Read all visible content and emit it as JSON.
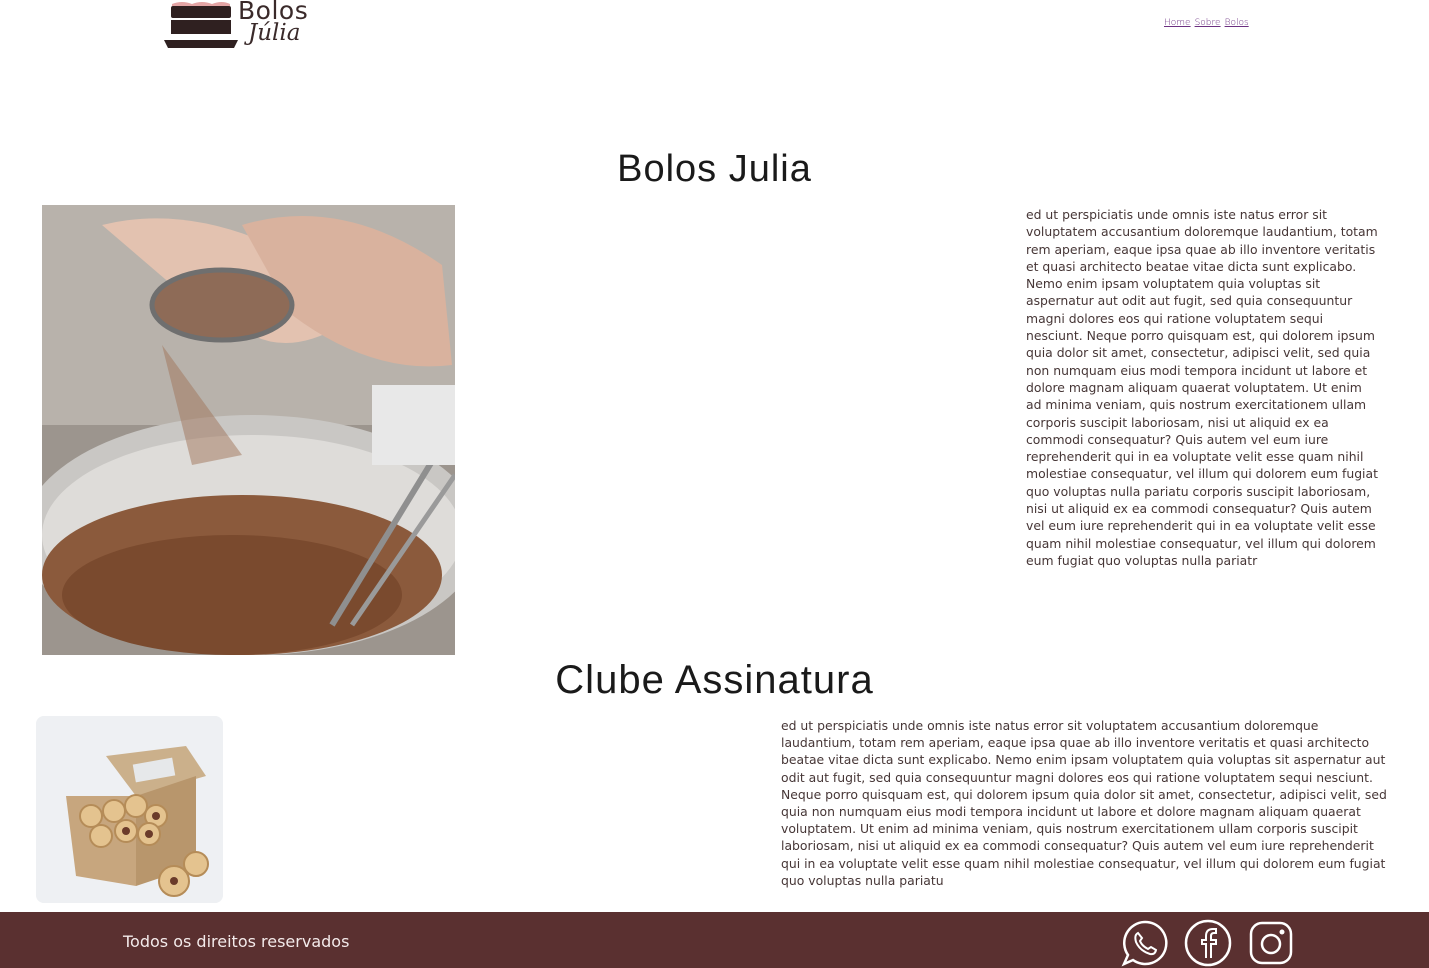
{
  "header": {
    "logo_line1": "Bolos",
    "logo_line2": "Júlia",
    "nav": [
      "Home",
      "Sobre",
      "Bolos"
    ]
  },
  "sections": [
    {
      "title": "Bolos Julia",
      "text": "ed ut perspiciatis unde omnis iste natus error sit voluptatem accusantium doloremque laudantium, totam rem aperiam, eaque ipsa quae ab illo inventore veritatis et quasi architecto beatae vitae dicta sunt explicabo. Nemo enim ipsam voluptatem quia voluptas sit aspernatur aut odit aut fugit, sed quia consequuntur magni dolores eos qui ratione voluptatem sequi nesciunt. Neque porro quisquam est, qui dolorem ipsum quia dolor sit amet, consectetur, adipisci velit, sed quia non numquam eius modi tempora incidunt ut labore et dolore magnam aliquam quaerat voluptatem. Ut enim ad minima veniam, quis nostrum exercitationem ullam corporis suscipit laboriosam, nisi ut aliquid ex ea commodi consequatur? Quis autem vel eum iure reprehenderit qui in ea voluptate velit esse quam nihil molestiae consequatur, vel illum qui dolorem eum fugiat quo voluptas nulla pariatu corporis suscipit laboriosam, nisi ut aliquid ex ea commodi consequatur? Quis autem vel eum iure reprehenderit qui in ea voluptate velit esse quam nihil molestiae consequatur, vel illum qui dolorem eum fugiat quo voluptas nulla pariatr"
    },
    {
      "title": "Clube Assinatura",
      "text": "ed ut perspiciatis unde omnis iste natus error sit voluptatem accusantium doloremque laudantium, totam rem aperiam, eaque ipsa quae ab illo inventore veritatis et quasi architecto beatae vitae dicta sunt explicabo. Nemo enim ipsam voluptatem quia voluptas sit aspernatur aut odit aut fugit, sed quia consequuntur magni dolores eos qui ratione voluptatem sequi nesciunt. Neque porro quisquam est, qui dolorem ipsum quia dolor sit amet, consectetur, adipisci velit, sed quia non numquam eius modi tempora incidunt ut labore et dolore magnam aliquam quaerat voluptatem. Ut enim ad minima veniam, quis nostrum exercitationem ullam corporis suscipit laboriosam, nisi ut aliquid ex ea commodi consequatur? Quis autem vel eum iure reprehenderit qui in ea voluptate velit esse quam nihil molestiae consequatur, vel illum qui dolorem eum fugiat quo voluptas nulla pariatu"
    }
  ],
  "footer": {
    "text": "Todos os direitos reservados",
    "icons": [
      "whatsapp-icon",
      "facebook-icon",
      "instagram-icon"
    ],
    "bg_color": "#5a3030"
  }
}
